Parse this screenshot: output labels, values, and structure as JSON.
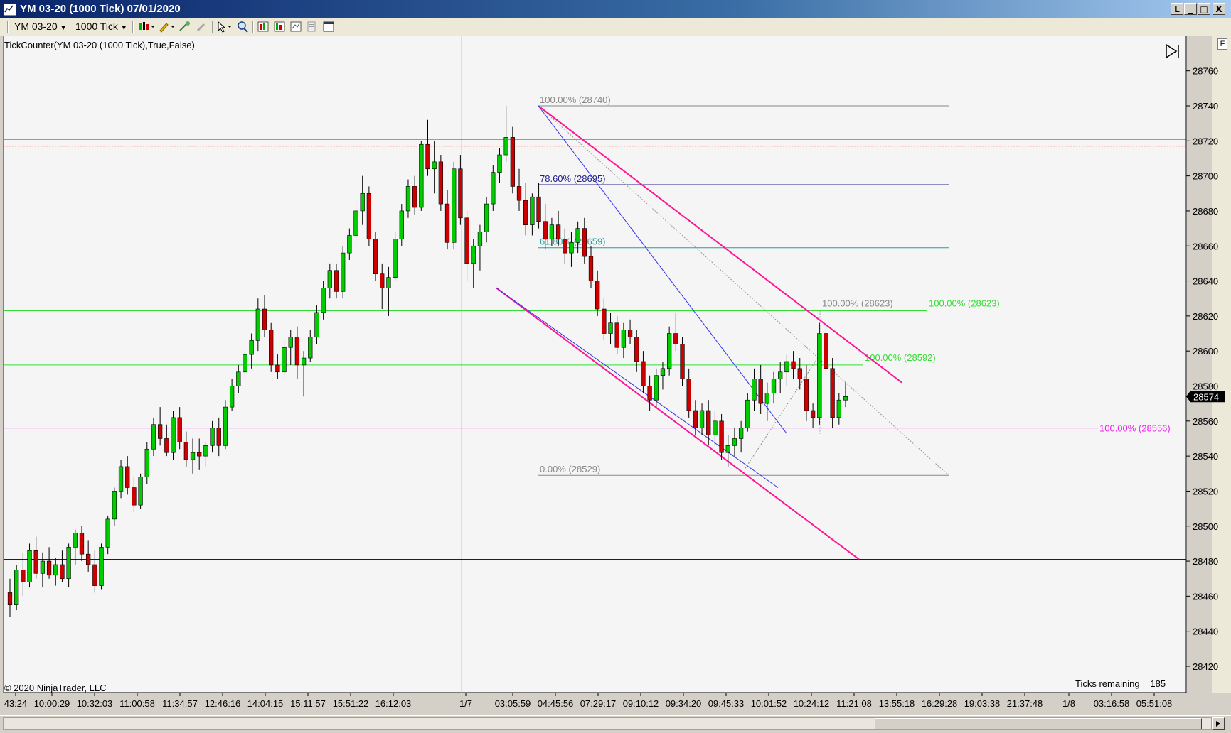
{
  "window": {
    "title": "YM 03-20 (1000 Tick)  07/01/2020",
    "buttons": {
      "restore_label": "L",
      "minimize_label": "_",
      "maximize_label": "□",
      "close_label": "X"
    }
  },
  "toolbar": {
    "instrument": "YM 03-20",
    "interval": "1000 Tick",
    "icons": [
      "bar-style-icon",
      "draw-pencil-icon",
      "crosshair-icon",
      "eraser-icon",
      "cursor-icon",
      "zoom-icon",
      "properties-icon",
      "strategies-icon",
      "data-box-icon",
      "copy-icon",
      "template-icon"
    ]
  },
  "chart": {
    "indicator_label": "TickCounter(YM 03-20 (1000 Tick),True,False)",
    "copyright": "© 2020 NinjaTrader, LLC",
    "ticks_remaining": "Ticks remaining = 185",
    "current_price": "28574",
    "f_button_label": "F",
    "colors": {
      "background": "#f5f5f5",
      "up_candle": "#00cc00",
      "down_candle": "#cc0000",
      "channel_magenta": "#ff1493",
      "channel_blue": "#3333ee",
      "fib_green": "#33dd33",
      "fib_magenta": "#ee22ee",
      "fib_gray": "#888888",
      "fib_navy": "#22228b",
      "fib_teal": "#2a9d9d"
    }
  },
  "chart_data": {
    "type": "candlestick",
    "y_axis": {
      "ticks": [
        28420,
        28440,
        28460,
        28480,
        28500,
        28520,
        28540,
        28560,
        28580,
        28600,
        28620,
        28640,
        28660,
        28680,
        28700,
        28720,
        28740,
        28760
      ],
      "ylim": [
        28405,
        28780
      ]
    },
    "x_axis": {
      "labels": [
        "43:24",
        "10:00:29",
        "10:32:03",
        "11:00:58",
        "11:34:57",
        "12:46:16",
        "14:04:15",
        "15:11:57",
        "15:51:22",
        "16:12:03",
        "1/7",
        "03:05:59",
        "04:45:56",
        "07:29:17",
        "09:10:12",
        "09:34:20",
        "09:45:33",
        "10:01:52",
        "10:24:12",
        "11:21:08",
        "13:55:18",
        "16:29:28",
        "19:03:38",
        "21:37:48",
        "1/8",
        "03:16:58",
        "05:51:08"
      ]
    },
    "horizontal_lines": [
      {
        "price": 28721,
        "color": "#000000"
      },
      {
        "price": 28717,
        "color": "#ff6633",
        "style": "dotted"
      },
      {
        "price": 28481,
        "color": "#000000"
      }
    ],
    "fib_levels": [
      {
        "label": "100.00% (28740)",
        "price": 28740,
        "color": "#888888"
      },
      {
        "label": "78.60% (28695)",
        "price": 28695,
        "color": "#22228b"
      },
      {
        "label": "61.80% (28659)",
        "price": 28659,
        "color": "#2a9d9d"
      },
      {
        "label": "0.00% (28529)",
        "price": 28529,
        "color": "#888888"
      },
      {
        "label": "100.00% (28623)",
        "price": 28623,
        "color": "#888888"
      },
      {
        "label": "100.00% (28623)",
        "price": 28623,
        "color": "#33dd33"
      },
      {
        "label": "100.00% (28592)",
        "price": 28592,
        "color": "#33dd33"
      },
      {
        "label": "100.00% (28556)",
        "price": 28556,
        "color": "#ee22ee"
      }
    ],
    "candles": [
      [
        28462,
        28470,
        28448,
        28455
      ],
      [
        28455,
        28478,
        28452,
        28475
      ],
      [
        28475,
        28485,
        28460,
        28468
      ],
      [
        28468,
        28490,
        28465,
        28486
      ],
      [
        28486,
        28494,
        28470,
        28473
      ],
      [
        28473,
        28485,
        28465,
        28480
      ],
      [
        28480,
        28488,
        28470,
        28472
      ],
      [
        28472,
        28482,
        28466,
        28478
      ],
      [
        28478,
        28486,
        28468,
        28470
      ],
      [
        28470,
        28490,
        28465,
        28488
      ],
      [
        28488,
        28498,
        28478,
        28496
      ],
      [
        28496,
        28500,
        28480,
        28484
      ],
      [
        28484,
        28492,
        28474,
        28478
      ],
      [
        28478,
        28486,
        28462,
        28466
      ],
      [
        28466,
        28490,
        28464,
        28488
      ],
      [
        28488,
        28506,
        28484,
        28504
      ],
      [
        28504,
        28522,
        28500,
        28520
      ],
      [
        28520,
        28538,
        28516,
        28534
      ],
      [
        28534,
        28540,
        28518,
        28522
      ],
      [
        28522,
        28528,
        28508,
        28512
      ],
      [
        28512,
        28530,
        28510,
        28528
      ],
      [
        28528,
        28548,
        28524,
        28544
      ],
      [
        28544,
        28562,
        28540,
        28558
      ],
      [
        28558,
        28568,
        28546,
        28550
      ],
      [
        28550,
        28558,
        28540,
        28542
      ],
      [
        28542,
        28566,
        28538,
        28562
      ],
      [
        28562,
        28568,
        28544,
        28548
      ],
      [
        28548,
        28554,
        28534,
        28538
      ],
      [
        28538,
        28550,
        28530,
        28542
      ],
      [
        28542,
        28550,
        28532,
        28540
      ],
      [
        28540,
        28548,
        28534,
        28546
      ],
      [
        28546,
        28560,
        28542,
        28556
      ],
      [
        28556,
        28562,
        28540,
        28546
      ],
      [
        28546,
        28572,
        28544,
        28568
      ],
      [
        28568,
        28584,
        28566,
        28580
      ],
      [
        28580,
        28592,
        28576,
        28588
      ],
      [
        28588,
        28600,
        28584,
        28598
      ],
      [
        28598,
        28610,
        28590,
        28606
      ],
      [
        28606,
        28630,
        28600,
        28624
      ],
      [
        28624,
        28632,
        28608,
        28612
      ],
      [
        28612,
        28616,
        28588,
        28592
      ],
      [
        28592,
        28598,
        28584,
        28588
      ],
      [
        28588,
        28606,
        28584,
        28602
      ],
      [
        28602,
        28612,
        28592,
        28608
      ],
      [
        28608,
        28614,
        28584,
        28592
      ],
      [
        28592,
        28600,
        28574,
        28596
      ],
      [
        28596,
        28612,
        28594,
        28608
      ],
      [
        28608,
        28626,
        28604,
        28622
      ],
      [
        28622,
        28640,
        28618,
        28636
      ],
      [
        28636,
        28650,
        28630,
        28646
      ],
      [
        28646,
        28650,
        28630,
        28634
      ],
      [
        28634,
        28660,
        28630,
        28656
      ],
      [
        28656,
        28670,
        28652,
        28666
      ],
      [
        28666,
        28686,
        28660,
        28680
      ],
      [
        28680,
        28700,
        28672,
        28690
      ],
      [
        28690,
        28694,
        28660,
        28664
      ],
      [
        28664,
        28668,
        28640,
        28644
      ],
      [
        28644,
        28650,
        28624,
        28636
      ],
      [
        28636,
        28648,
        28620,
        28642
      ],
      [
        28642,
        28668,
        28640,
        28664
      ],
      [
        28664,
        28684,
        28660,
        28680
      ],
      [
        28680,
        28698,
        28676,
        28694
      ],
      [
        28694,
        28700,
        28678,
        28682
      ],
      [
        28682,
        28720,
        28680,
        28718
      ],
      [
        28718,
        28732,
        28700,
        28704
      ],
      [
        28704,
        28720,
        28690,
        28708
      ],
      [
        28708,
        28712,
        28680,
        28684
      ],
      [
        28684,
        28692,
        28658,
        28662
      ],
      [
        28662,
        28708,
        28658,
        28704
      ],
      [
        28704,
        28712,
        28672,
        28676
      ],
      [
        28676,
        28680,
        28640,
        28650
      ],
      [
        28650,
        28664,
        28636,
        28660
      ],
      [
        28660,
        28672,
        28646,
        28668
      ],
      [
        28668,
        28688,
        28662,
        28684
      ],
      [
        28684,
        28706,
        28680,
        28702
      ],
      [
        28702,
        28716,
        28696,
        28712
      ],
      [
        28712,
        28740,
        28708,
        28722
      ],
      [
        28722,
        28728,
        28690,
        28694
      ],
      [
        28694,
        28704,
        28680,
        28686
      ],
      [
        28686,
        28696,
        28666,
        28672
      ],
      [
        28672,
        28690,
        28666,
        28688
      ],
      [
        28688,
        28696,
        28670,
        28674
      ],
      [
        28674,
        28684,
        28658,
        28664
      ],
      [
        28664,
        28676,
        28660,
        28672
      ],
      [
        28672,
        28680,
        28660,
        28664
      ],
      [
        28664,
        28670,
        28650,
        28656
      ],
      [
        28656,
        28668,
        28648,
        28662
      ],
      [
        28662,
        28674,
        28656,
        28670
      ],
      [
        28670,
        28676,
        28650,
        28654
      ],
      [
        28654,
        28660,
        28636,
        28640
      ],
      [
        28640,
        28646,
        28620,
        28624
      ],
      [
        28624,
        28630,
        28606,
        28610
      ],
      [
        28610,
        28622,
        28604,
        28616
      ],
      [
        28616,
        28620,
        28598,
        28602
      ],
      [
        28602,
        28616,
        28596,
        28612
      ],
      [
        28612,
        28618,
        28604,
        28608
      ],
      [
        28608,
        28612,
        28588,
        28594
      ],
      [
        28594,
        28600,
        28576,
        28580
      ],
      [
        28580,
        28586,
        28566,
        28572
      ],
      [
        28572,
        28590,
        28568,
        28586
      ],
      [
        28586,
        28594,
        28578,
        28590
      ],
      [
        28590,
        28614,
        28586,
        28610
      ],
      [
        28610,
        28622,
        28600,
        28604
      ],
      [
        28604,
        28608,
        28580,
        28584
      ],
      [
        28584,
        28590,
        28562,
        28566
      ],
      [
        28566,
        28572,
        28552,
        28556
      ],
      [
        28556,
        28570,
        28552,
        28566
      ],
      [
        28566,
        28572,
        28546,
        28552
      ],
      [
        28552,
        28566,
        28546,
        28560
      ],
      [
        28560,
        28564,
        28538,
        28542
      ],
      [
        28542,
        28552,
        28534,
        28546
      ],
      [
        28546,
        28556,
        28540,
        28550
      ],
      [
        28550,
        28560,
        28542,
        28556
      ],
      [
        28556,
        28576,
        28554,
        28572
      ],
      [
        28572,
        28590,
        28566,
        28584
      ],
      [
        28584,
        28592,
        28564,
        28570
      ],
      [
        28570,
        28582,
        28560,
        28576
      ],
      [
        28576,
        28588,
        28570,
        28584
      ],
      [
        28584,
        28594,
        28576,
        28588
      ],
      [
        28588,
        28598,
        28580,
        28594
      ],
      [
        28594,
        28600,
        28584,
        28590
      ],
      [
        28590,
        28596,
        28578,
        28584
      ],
      [
        28584,
        28592,
        28560,
        28566
      ],
      [
        28566,
        28570,
        28556,
        28562
      ],
      [
        28562,
        28616,
        28558,
        28610
      ],
      [
        28610,
        28614,
        28586,
        28590
      ],
      [
        28590,
        28596,
        28556,
        28562
      ],
      [
        28562,
        28576,
        28558,
        28572
      ],
      [
        28572,
        28582,
        28568,
        28574
      ]
    ]
  }
}
